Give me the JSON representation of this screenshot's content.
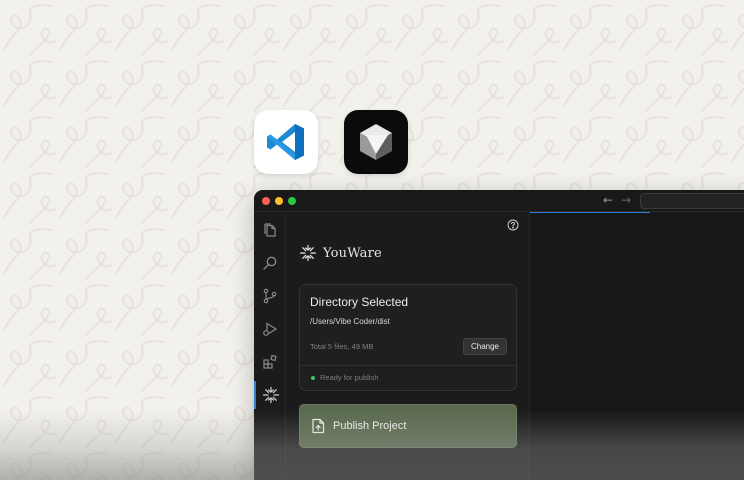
{
  "apps": {
    "vscode": {
      "icon": "vscode-logo-icon",
      "color": "#0078d4"
    },
    "cursor": {
      "icon": "cursor-logo-icon",
      "color": "#0b0b0b"
    }
  },
  "window": {
    "traffic_lights": [
      "#ff5f57",
      "#febc2e",
      "#28c840"
    ],
    "nav": {
      "back": "←",
      "forward": "→"
    }
  },
  "activity_bar": {
    "items": [
      {
        "icon": "files-icon"
      },
      {
        "icon": "search-icon"
      },
      {
        "icon": "source-control-icon"
      },
      {
        "icon": "run-debug-icon"
      },
      {
        "icon": "extensions-icon"
      },
      {
        "icon": "youware-icon",
        "active": true
      }
    ],
    "accent": "#2f7fd6"
  },
  "panel": {
    "help_icon": "question-circle-icon",
    "brand": {
      "name": "YouWare",
      "icon": "youware-logo-icon"
    },
    "directory": {
      "title": "Directory Selected",
      "path": "/Users/Vibe Coder/dist",
      "meta": "Total 5 files, 49 MB",
      "change_label": "Change",
      "status": "Ready for publish",
      "status_color": "#3ec46d"
    },
    "publish": {
      "label": "Publish Project",
      "icon": "upload-file-icon",
      "color": "#5b6b4f"
    }
  }
}
